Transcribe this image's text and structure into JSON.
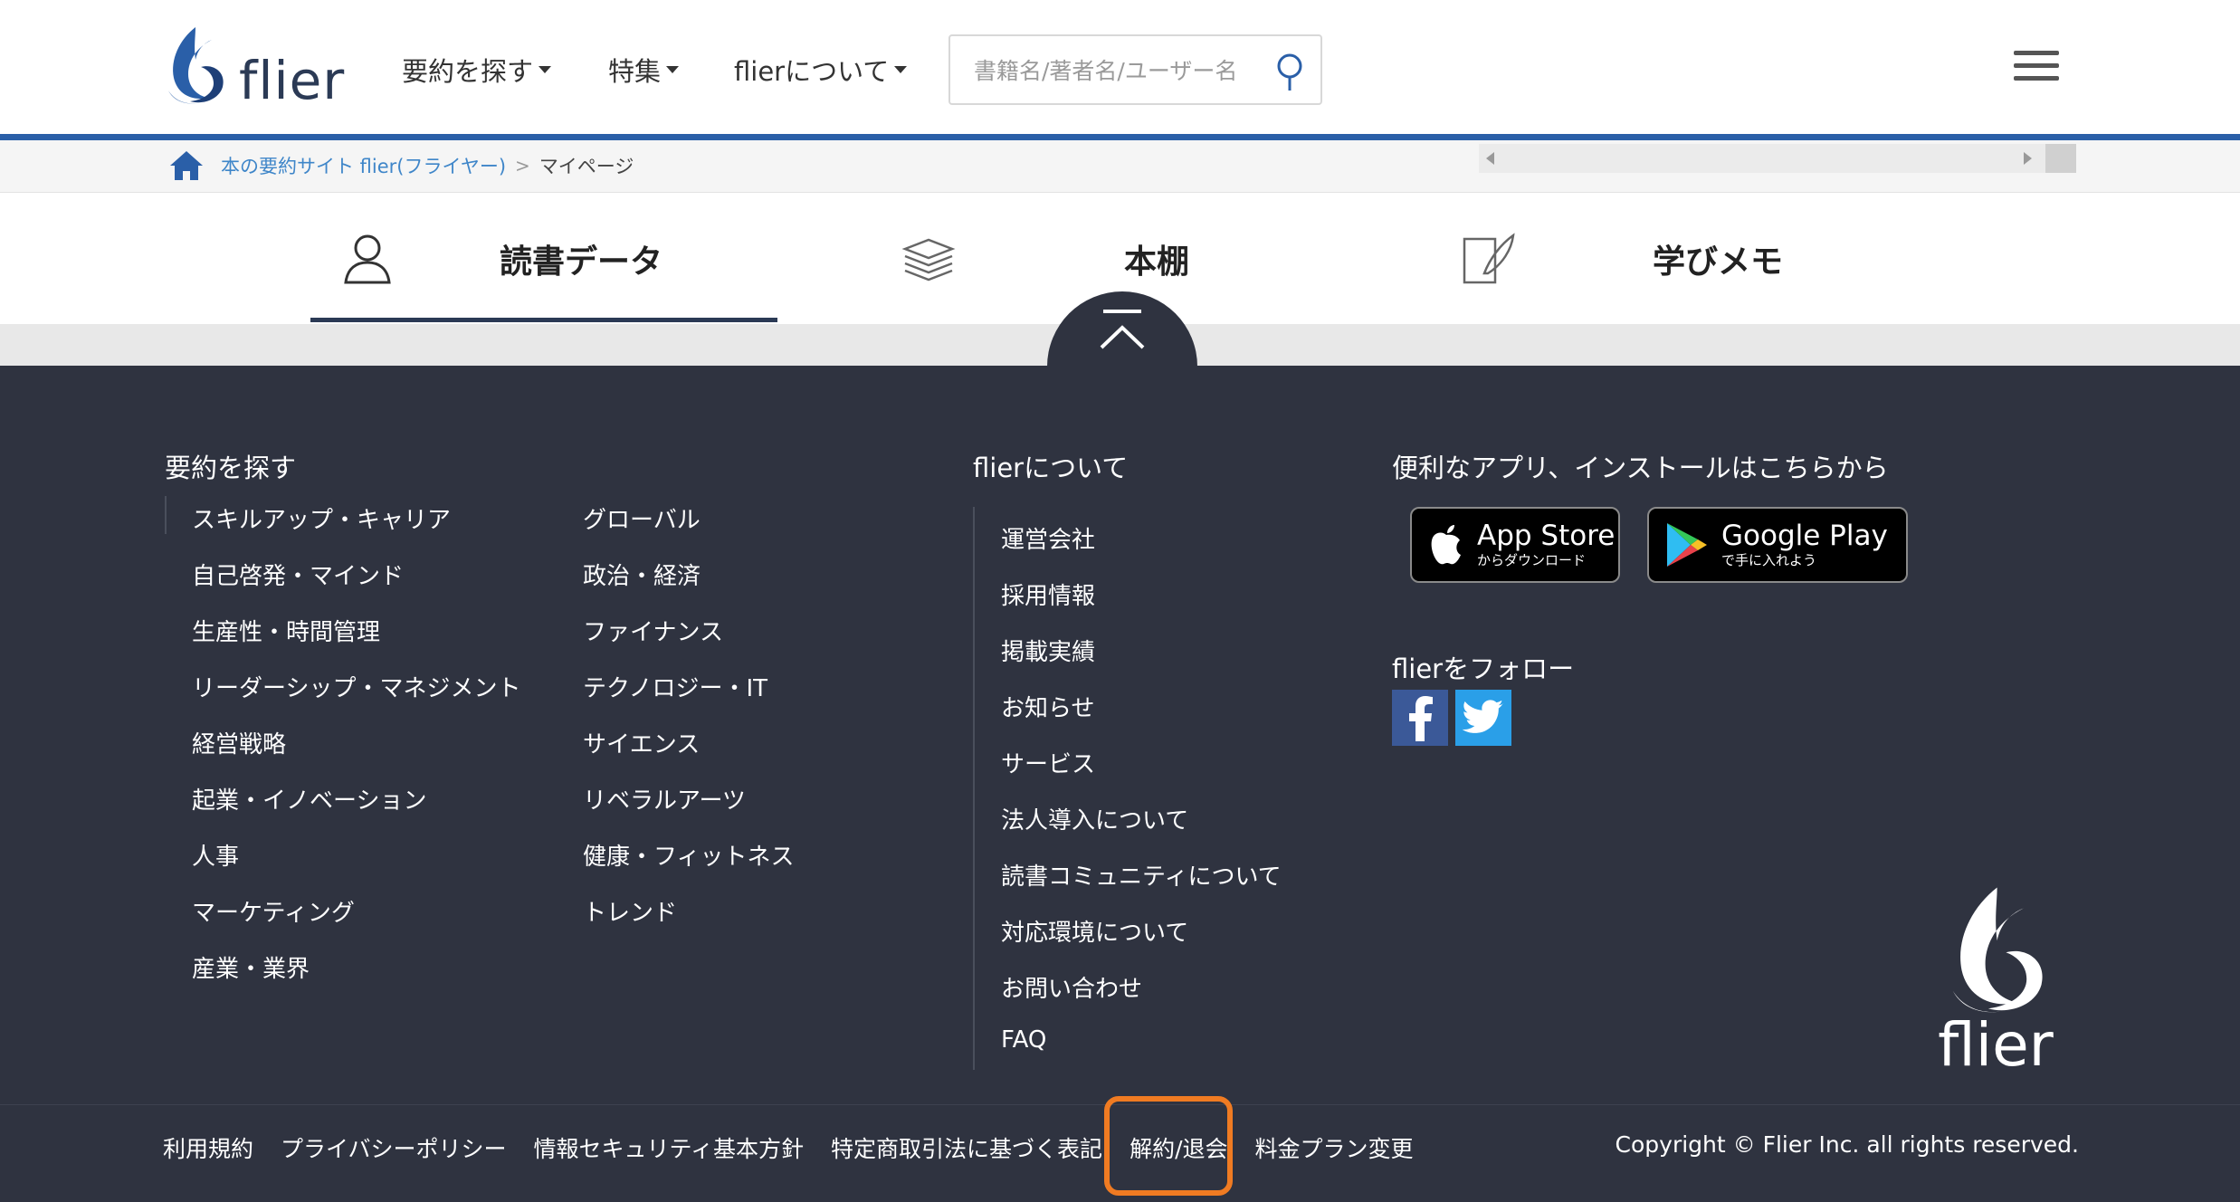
{
  "header": {
    "logo_text": "flier",
    "nav": [
      {
        "label": "要約を探す"
      },
      {
        "label": "特集"
      },
      {
        "label": "flierについて"
      }
    ],
    "search_placeholder": "書籍名/著者名/ユーザー名"
  },
  "breadcrumb": {
    "home_link": "本の要約サイト flier(フライヤー)",
    "separator": ">",
    "current": "マイページ"
  },
  "tabs": [
    {
      "label": "読書データ",
      "active": true
    },
    {
      "label": "本棚",
      "active": false
    },
    {
      "label": "学びメモ",
      "active": false
    }
  ],
  "footer": {
    "browse_heading": "要約を探す",
    "categories_col1": [
      "スキルアップ・キャリア",
      "自己啓発・マインド",
      "生産性・時間管理",
      "リーダーシップ・マネジメント",
      "経営戦略",
      "起業・イノベーション",
      "人事",
      "マーケティング",
      "産業・業界"
    ],
    "categories_col2": [
      "グローバル",
      "政治・経済",
      "ファイナンス",
      "テクノロジー・IT",
      "サイエンス",
      "リベラルアーツ",
      "健康・フィットネス",
      "トレンド"
    ],
    "about_heading": "flierについて",
    "about_links": [
      "運営会社",
      "採用情報",
      "掲載実績",
      "お知らせ",
      "サービス",
      "法人導入について",
      "読書コミュニティについて",
      "対応環境について",
      "お問い合わせ",
      "FAQ"
    ],
    "apps_heading": "便利なアプリ、インストールはこちらから",
    "app_store": {
      "big": "App Store",
      "small": "からダウンロード"
    },
    "google_play": {
      "big": "Google Play",
      "small": "で手に入れよう"
    },
    "follow_heading": "flierをフォロー",
    "logo_text": "flier",
    "bottom_links": [
      "利用規約",
      "プライバシーポリシー",
      "情報セキュリティ基本方針",
      "特定商取引法に基づく表記",
      "解約/退会",
      "料金プラン変更"
    ],
    "copyright": "Copyright © Flier Inc. all rights reserved."
  },
  "colors": {
    "brand_blue": "#2a5fa8",
    "link_blue": "#3f86c9",
    "footer_bg": "#2f3340",
    "highlight": "#f07b22"
  }
}
